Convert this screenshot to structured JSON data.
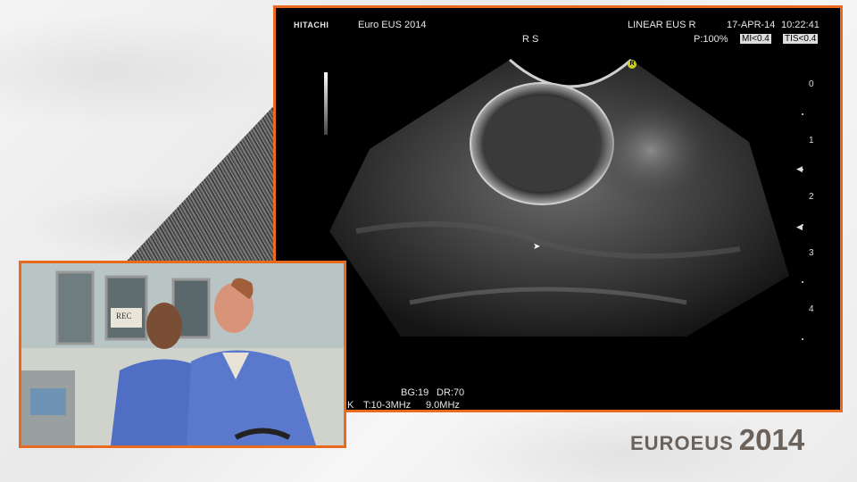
{
  "ultrasound": {
    "brand": "HITACHI",
    "title": "Euro EUS 2014",
    "mode": "LINEAR EUS R",
    "date": "17-APR-14",
    "time": "10:22:41",
    "orientation": "R S",
    "power": "P:100%",
    "mi": "MI<0.4",
    "tis": "TIS<0.4",
    "bg": "BG:19",
    "dr": "DR:70",
    "freq_range": "T:10-3MHz",
    "freq": "9.0MHz",
    "k_label": "K",
    "depth_ticks": [
      "0",
      "1",
      "2",
      "3",
      "4"
    ],
    "marker_label": "R"
  },
  "video": {
    "rec_label": "REC"
  },
  "logo": {
    "prefix": "EUROEUS",
    "year": "2014"
  },
  "colors": {
    "accent": "#e86a1f",
    "logo": "#6b625c"
  }
}
